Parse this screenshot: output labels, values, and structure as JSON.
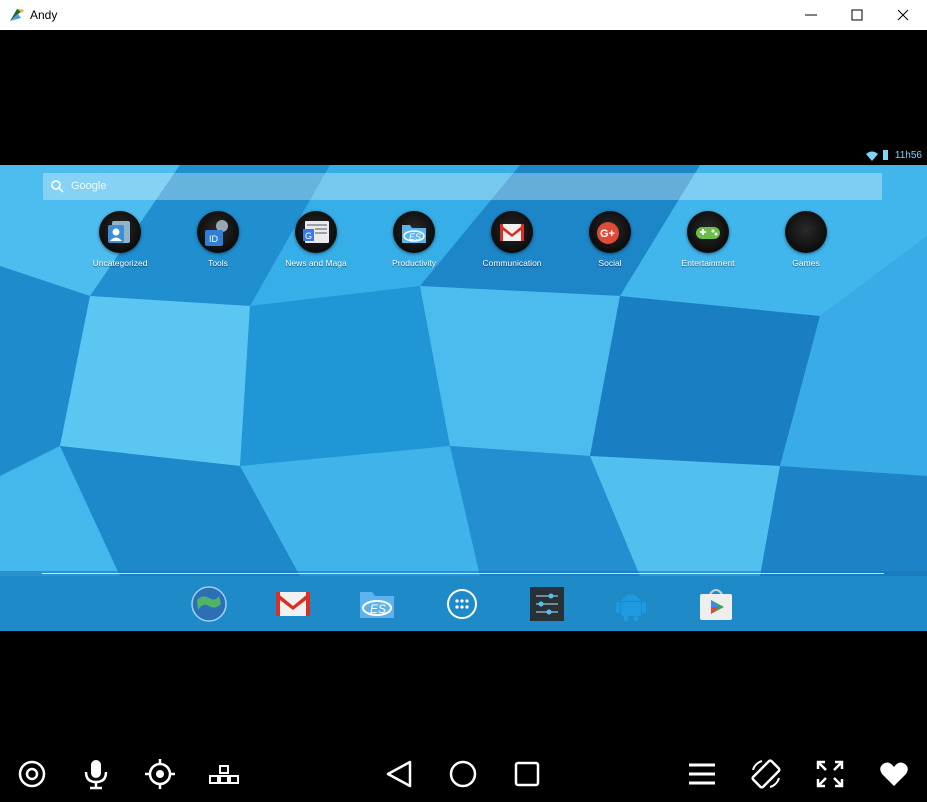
{
  "window": {
    "title": "Andy",
    "controls": [
      "minimize",
      "maximize",
      "close"
    ]
  },
  "android": {
    "status_bar": {
      "time": "11h56",
      "icons": [
        "wifi-icon",
        "battery-icon"
      ]
    },
    "search": {
      "placeholder": "Google"
    },
    "folders": [
      {
        "label": "Uncategorized",
        "icon": "contacts-icon"
      },
      {
        "label": "Tools",
        "icon": "tools-icon"
      },
      {
        "label": "News and Maga",
        "icon": "news-icon"
      },
      {
        "label": "Productivity",
        "icon": "es-file-explorer-icon"
      },
      {
        "label": "Communication",
        "icon": "gmail-icon"
      },
      {
        "label": "Social",
        "icon": "google-plus-icon"
      },
      {
        "label": "Entertainment",
        "icon": "gamepad-icon"
      },
      {
        "label": "Games",
        "icon": "empty-folder-icon"
      }
    ],
    "dock": [
      "browser-icon",
      "gmail-icon",
      "es-file-explorer-icon",
      "app-drawer-icon",
      "settings-icon",
      "android-icon",
      "play-store-icon"
    ]
  },
  "controls": {
    "left": [
      "camera-icon",
      "microphone-icon",
      "location-icon",
      "keymap-icon"
    ],
    "center": [
      "back-icon",
      "home-icon",
      "recents-icon"
    ],
    "right": [
      "menu-icon",
      "rotate-icon",
      "fullscreen-icon",
      "favorite-icon"
    ]
  },
  "colors": {
    "accent": "#2aa3e0",
    "status_text": "#7fd3f7"
  }
}
